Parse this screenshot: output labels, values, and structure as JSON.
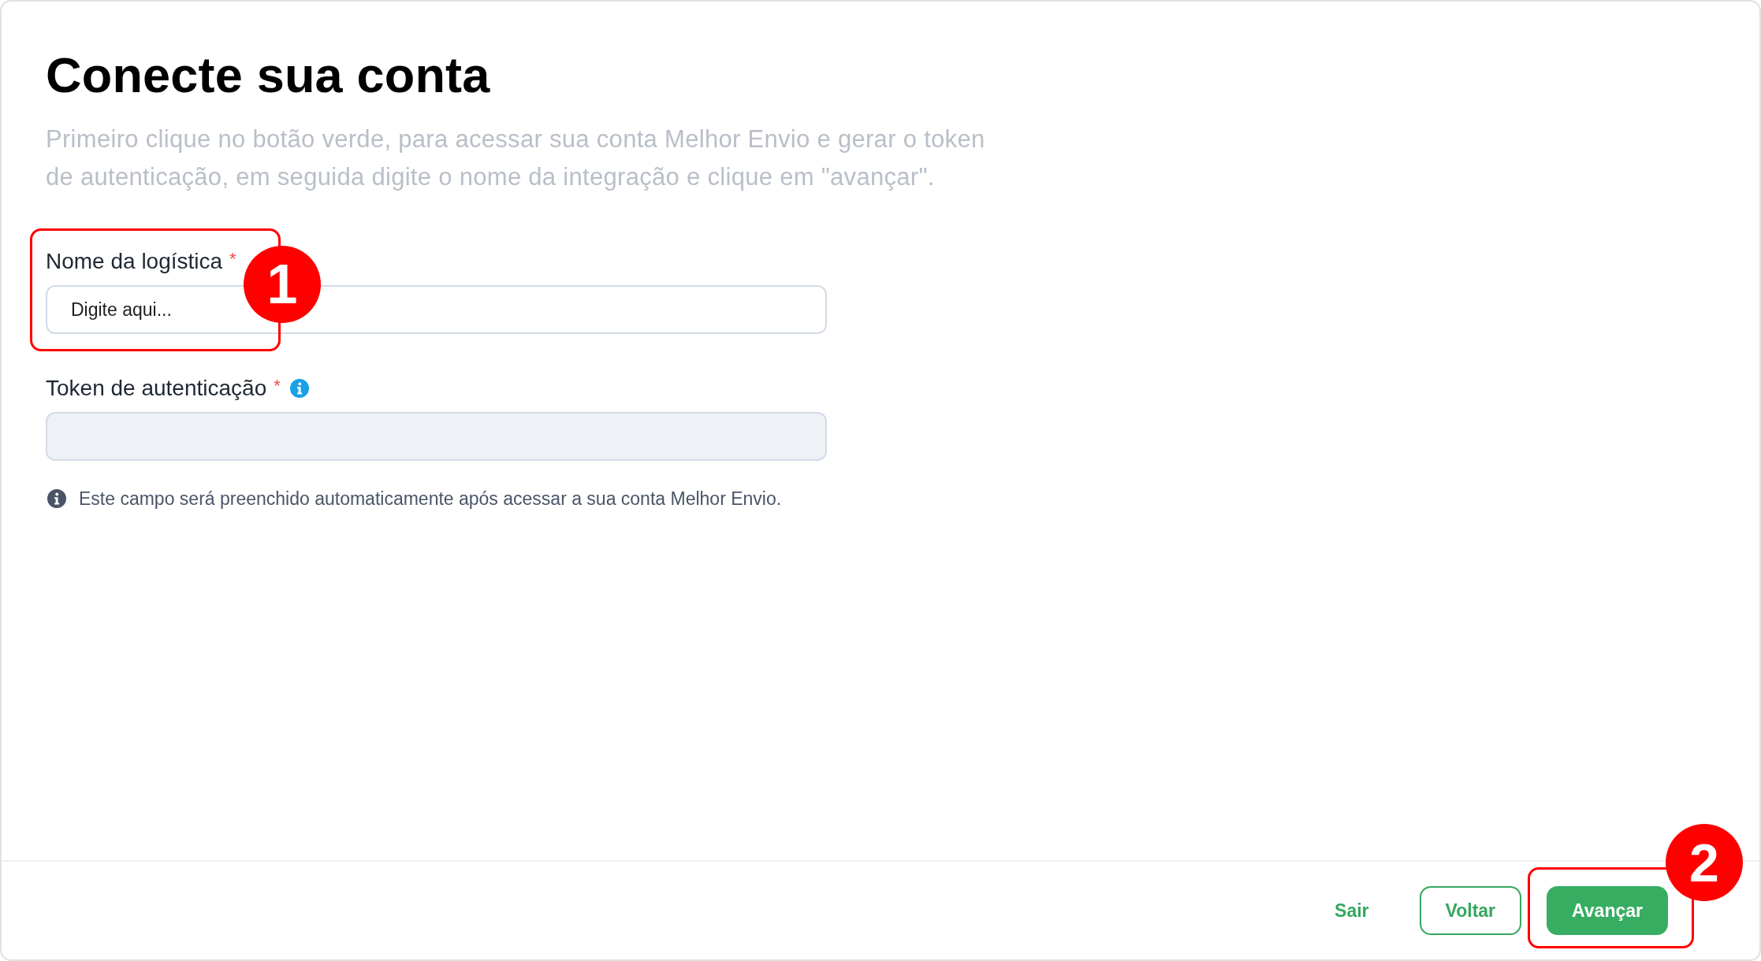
{
  "title": "Conecte sua conta",
  "description": "Primeiro clique no botão verde, para acessar sua conta Melhor Envio e gerar o token de autenticação, em seguida digite o nome da integração e clique em \"avançar\".",
  "fields": [
    {
      "label": "Nome da logística",
      "required_mark": "*",
      "info_icon": false,
      "placeholder": "Digite aqui...",
      "disabled": false
    },
    {
      "label": "Token de autenticação",
      "required_mark": "*",
      "info_icon": true,
      "disabled": true,
      "hint": "Este campo será preenchido automaticamente após acessar a sua conta Melhor Envio."
    }
  ],
  "buttons": [
    {
      "label": "Sair",
      "kind": "link"
    },
    {
      "label": "Voltar",
      "kind": "outline"
    },
    {
      "label": "Avançar",
      "kind": "primary"
    }
  ],
  "annotations": [
    {
      "number": "1"
    },
    {
      "number": "2"
    }
  ]
}
